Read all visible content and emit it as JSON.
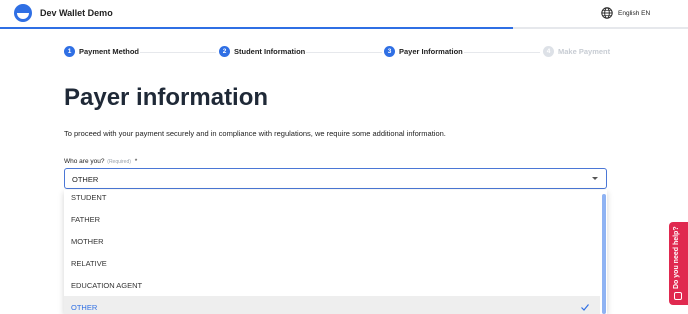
{
  "app": {
    "title": "Dev Wallet Demo"
  },
  "language": {
    "label": "English EN",
    "icon": "globe-icon"
  },
  "progress": {
    "fraction": 0.745
  },
  "steps": [
    {
      "number": "1",
      "label": "Payment Method",
      "state": "complete"
    },
    {
      "number": "2",
      "label": "Student Information",
      "state": "complete"
    },
    {
      "number": "3",
      "label": "Payer Information",
      "state": "active"
    },
    {
      "number": "4",
      "label": "Make Payment",
      "state": "disabled"
    }
  ],
  "page": {
    "title": "Payer information",
    "intro": "To proceed with your payment securely and in compliance with regulations, we require some additional information."
  },
  "field": {
    "label": "Who are you?",
    "required_text": "(Required)",
    "required_marker": "*",
    "value": "OTHER",
    "options": [
      "STUDENT",
      "FATHER",
      "MOTHER",
      "RELATIVE",
      "EDUCATION AGENT",
      "OTHER"
    ],
    "selected_index": 5
  },
  "help": {
    "label": "Do you need help?",
    "icon": "chat-icon"
  },
  "colors": {
    "accent": "#2f6fe4",
    "help": "#e0294f",
    "disabled": "#c7ccd3"
  }
}
